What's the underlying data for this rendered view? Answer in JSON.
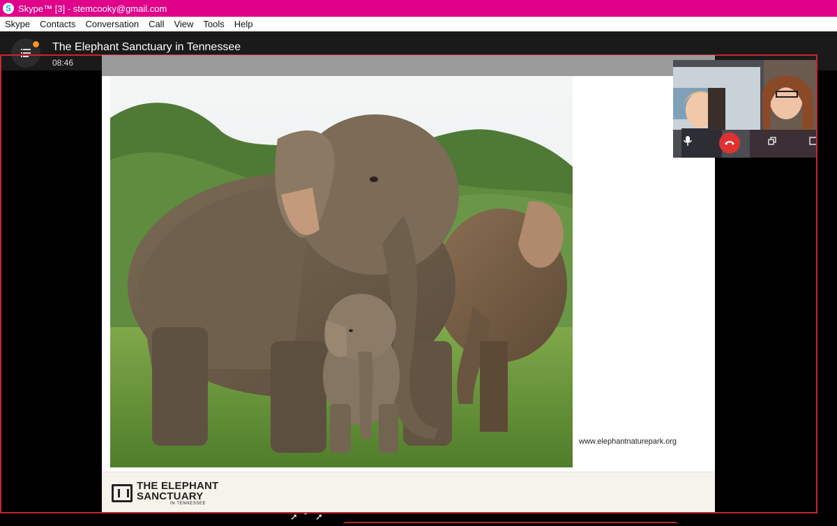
{
  "window": {
    "title": "Skype™ [3] - stemcooky@gmail.com",
    "logo_letter": "S"
  },
  "menu": {
    "items": [
      "Skype",
      "Contacts",
      "Conversation",
      "Call",
      "View",
      "Tools",
      "Help"
    ]
  },
  "call": {
    "title": "The Elephant Sanctuary in Tennessee",
    "timer": "08:46",
    "notification_color": "#f39a1c",
    "frame_color": "#c8262d"
  },
  "slide": {
    "credit": "www.elephantnaturepark.org",
    "logo_line1": "THE ELEPHANT",
    "logo_line2": "SANCTUARY",
    "logo_line3": "IN TENNESSEE"
  },
  "self_video": {
    "controls": [
      "microphone-icon",
      "end-call-icon",
      "popout-icon",
      "fullscreen-icon"
    ],
    "end_call_color": "#e03131"
  },
  "colors": {
    "titlebar": "#e0008a",
    "accent": "#00aff0"
  }
}
